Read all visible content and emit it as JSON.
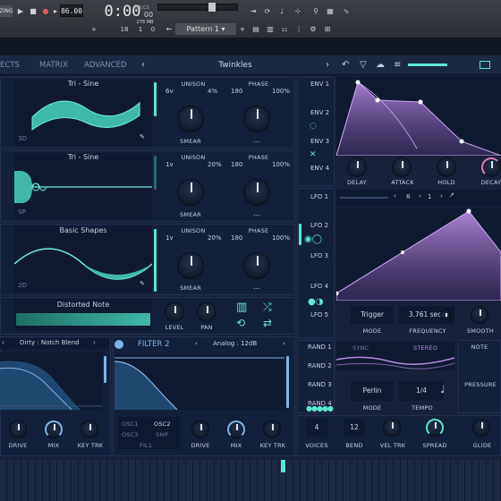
{
  "daw": {
    "tempo": "86.00",
    "time": "0:00",
    "time_small": "00",
    "bars_label": "M:S:CS",
    "num1": "18",
    "num2": "1",
    "num3": "278 MB",
    "num4": "0",
    "pattern": "Pattern 1",
    "left_tag": "ZING"
  },
  "synth": {
    "tabs": [
      "ECTS",
      "MATRIX",
      "ADVANCED"
    ],
    "preset_name": "Twinkles",
    "oscillators": [
      {
        "wave": "Tri - Sine",
        "unison_voices": "6v",
        "unison_detune": "4%",
        "phase": "180",
        "phase_pct": "100%",
        "mode": "3D",
        "knob_label": "SMEAR"
      },
      {
        "wave": "Tri - Sine",
        "unison_voices": "1v",
        "unison_detune": "20%",
        "phase": "180",
        "phase_pct": "100%",
        "mode": "SP",
        "knob_label": "SMEAR"
      },
      {
        "wave": "Basic Shapes",
        "unison_voices": "1v",
        "unison_detune": "20%",
        "phase": "180",
        "phase_pct": "100%",
        "mode": "2D",
        "knob_label": "SMEAR"
      }
    ],
    "unison_label": "UNISON",
    "phase_label": "PHASE",
    "dash": "---",
    "sample": {
      "name": "Distorted Note",
      "level": "LEVEL",
      "pan": "PAN"
    },
    "envelopes": {
      "items": [
        "ENV 1",
        "ENV 2",
        "ENV 3",
        "ENV 4"
      ],
      "knobs": [
        "DELAY",
        "ATTACK",
        "HOLD",
        "DECAY"
      ]
    },
    "lfo": {
      "items": [
        "LFO 1",
        "LFO 2",
        "LFO 3",
        "LFO 4",
        "LFO 5"
      ],
      "grid_x": "8",
      "grid_y": "1",
      "mode_value": "Trigger",
      "mode_label": "MODE",
      "frequency_value": "3.761 secs",
      "frequency_label": "FREQUENCY",
      "smooth_label": "SMOOTH"
    },
    "random": {
      "items": [
        "RAND 1",
        "RAND 2",
        "RAND 3",
        "RAND 4"
      ],
      "sync": "SYNC",
      "stereo": "STEREO",
      "style_value": "Perlin",
      "style_label": "MODE",
      "tempo_value": "1/4",
      "tempo_label": "TEMPO"
    },
    "side": {
      "note": "NOTE",
      "pressure": "PRESSURE"
    },
    "filter1": {
      "type": "Dirty : Notch Blend",
      "knobs": [
        "DRIVE",
        "MIX",
        "KEY TRK"
      ]
    },
    "filter2": {
      "title": "FILTER 2",
      "type": "Analog : 12dB",
      "routes": [
        "OSC1",
        "OSC2",
        "OSC3",
        "SMP",
        "FIL1"
      ],
      "knobs": [
        "DRIVE",
        "MIX",
        "KEY TRK"
      ]
    },
    "voice": {
      "voices_value": "4",
      "voices_label": "VOICES",
      "bend_value": "12",
      "bend_label": "BEND",
      "veltrk_label": "VEL TRK",
      "spread_label": "SPREAD",
      "glide_label": "GLIDE"
    }
  },
  "colors": {
    "cyan": "#5ce8d0",
    "purple": "#b58ae0",
    "panel": "#13203a"
  }
}
